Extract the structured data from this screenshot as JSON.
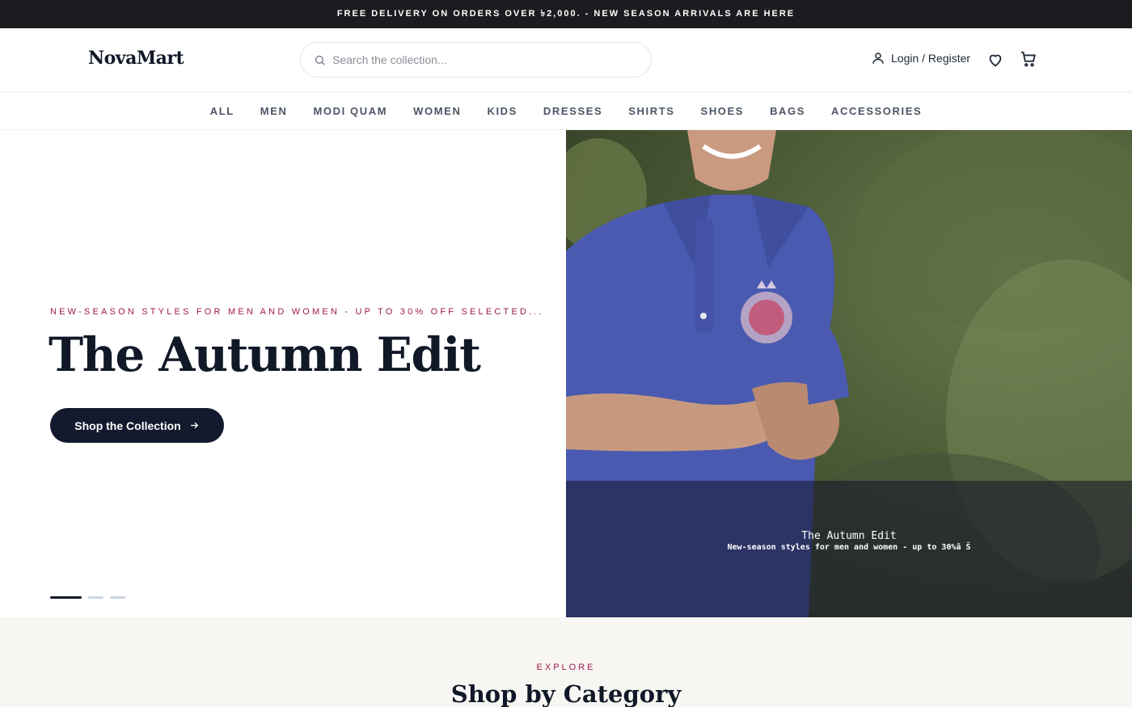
{
  "announcement": "FREE DELIVERY ON ORDERS OVER ৳2,000. - NEW SEASON ARRIVALS ARE HERE",
  "header": {
    "logo": "NovaMart",
    "search_placeholder": "Search the collection...",
    "account_label": "Login / Register",
    "icons": [
      "search-icon",
      "user-icon",
      "heart-icon",
      "cart-icon"
    ]
  },
  "nav": [
    "ALL",
    "MEN",
    "MODI QUAM",
    "WOMEN",
    "KIDS",
    "DRESSES",
    "SHIRTS",
    "SHOES",
    "BAGS",
    "ACCESSORIES"
  ],
  "hero": {
    "eyebrow": "NEW-SEASON STYLES FOR MEN AND WOMEN - UP TO 30% OFF SELECTED...",
    "title": "The Autumn Edit",
    "cta": "Shop the Collection",
    "slides_total": 3,
    "active_slide": 1,
    "image_caption_title": "The Autumn Edit",
    "image_caption_sub": "New-season styles for men and women - up to 30%â Š"
  },
  "section": {
    "eyebrow": "EXPLORE",
    "title": "Shop by Category"
  },
  "colors": {
    "accent": "#a0194a",
    "dark": "#141a2e",
    "announcement_bg": "#1b1c1f",
    "section_bg": "#f8f6f3"
  }
}
